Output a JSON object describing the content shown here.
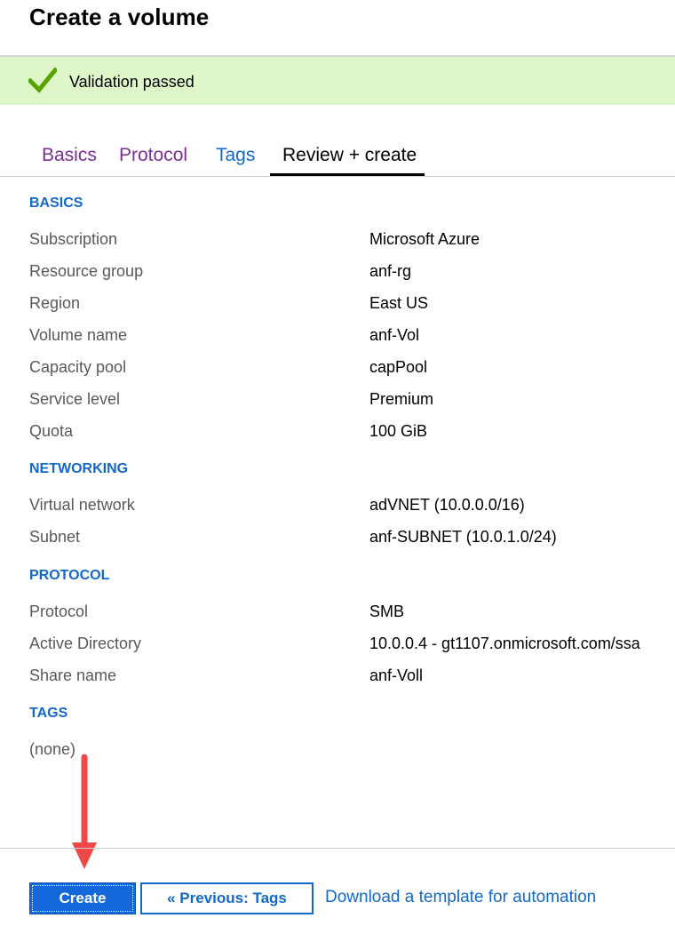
{
  "page": {
    "title": "Create a volume"
  },
  "banner": {
    "message": "Validation passed",
    "icon": "checkmark-icon",
    "color": "#57a300"
  },
  "tabs": [
    {
      "label": "Basics",
      "state": "visited"
    },
    {
      "label": "Protocol",
      "state": "visited"
    },
    {
      "label": "Tags",
      "state": "link"
    },
    {
      "label": "Review + create",
      "state": "active"
    }
  ],
  "sections": {
    "basics": {
      "heading": "BASICS",
      "rows": [
        {
          "label": "Subscription",
          "value": "Microsoft Azure"
        },
        {
          "label": "Resource group",
          "value": "anf-rg"
        },
        {
          "label": "Region",
          "value": "East US"
        },
        {
          "label": "Volume name",
          "value": "anf-Vol"
        },
        {
          "label": "Capacity pool",
          "value": "capPool"
        },
        {
          "label": "Service level",
          "value": "Premium"
        },
        {
          "label": "Quota",
          "value": "100 GiB"
        }
      ]
    },
    "networking": {
      "heading": "NETWORKING",
      "rows": [
        {
          "label": "Virtual network",
          "value": "adVNET (10.0.0.0/16)"
        },
        {
          "label": "Subnet",
          "value": "anf-SUBNET (10.0.1.0/24)"
        }
      ]
    },
    "protocol": {
      "heading": "PROTOCOL",
      "rows": [
        {
          "label": "Protocol",
          "value": "SMB"
        },
        {
          "label": "Active Directory",
          "value": "10.0.0.4 - gt1107.onmicrosoft.com/ssa"
        },
        {
          "label": "Share name",
          "value": "anf-Voll"
        }
      ]
    },
    "tags": {
      "heading": "TAGS",
      "empty_text": "(none)"
    }
  },
  "footer": {
    "create_label": "Create",
    "previous_label": "« Previous: Tags",
    "download_link": "Download a template for automation"
  },
  "annotation": {
    "icon": "red-arrow-down-icon",
    "color": "#f04848"
  },
  "colors": {
    "accent": "#1468c6",
    "visited": "#7a2e96",
    "banner_bg": "#dff6c9"
  }
}
